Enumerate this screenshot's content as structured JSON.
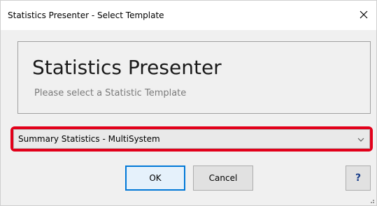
{
  "window": {
    "title": "Statistics Presenter - Select Template"
  },
  "header": {
    "title": "Statistics Presenter",
    "subtitle": "Please select a Statistic Template"
  },
  "template_select": {
    "selected": "Summary Statistics - MultiSystem"
  },
  "buttons": {
    "ok_label": "OK",
    "cancel_label": "Cancel",
    "help_label": "?"
  },
  "colors": {
    "highlight": "#e2001a",
    "default_button_border": "#0078d7"
  },
  "icons": {
    "close": "close-icon",
    "dropdown": "chevron-down-icon",
    "resize": "resize-grip-icon"
  }
}
